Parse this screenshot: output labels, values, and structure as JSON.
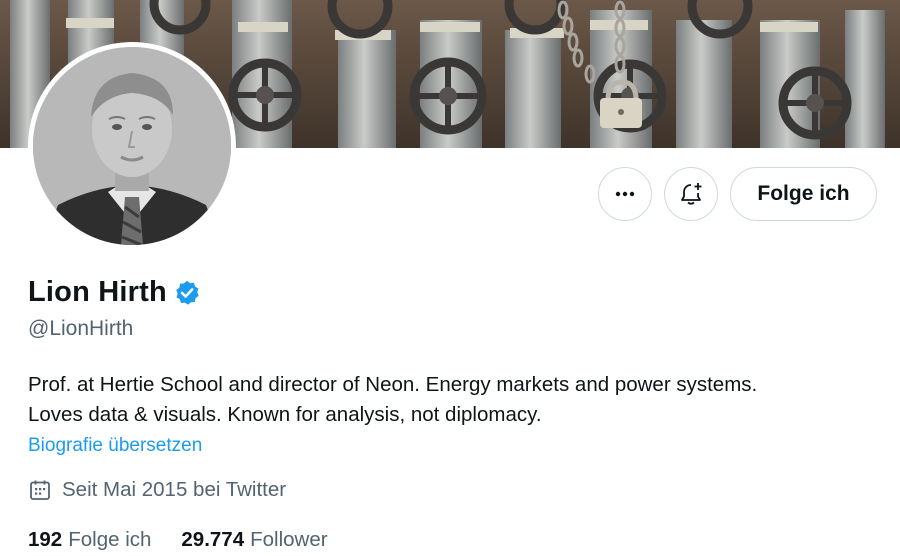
{
  "profile": {
    "name": "Lion Hirth",
    "handle": "@LionHirth",
    "bio_lines": [
      "Prof. at Hertie School and director of Neon. Energy markets and power systems.",
      "Loves data & visuals. Known for analysis, not diplomacy."
    ],
    "translate_bio": "Biografie übersetzen",
    "joined": "Seit Mai 2015 bei Twitter",
    "following_count": "192",
    "following_label": "Folge ich",
    "followers_count": "29.774",
    "followers_label": "Follower",
    "verified_icon": "verified-badge-icon"
  },
  "actions": {
    "more_icon": "more-dots-icon",
    "notify_icon": "bell-plus-icon",
    "follow_label": "Folge ich"
  },
  "colors": {
    "accent": "#1d9bf0",
    "text": "#0f1419",
    "muted": "#536471",
    "border": "#cfd9de"
  }
}
